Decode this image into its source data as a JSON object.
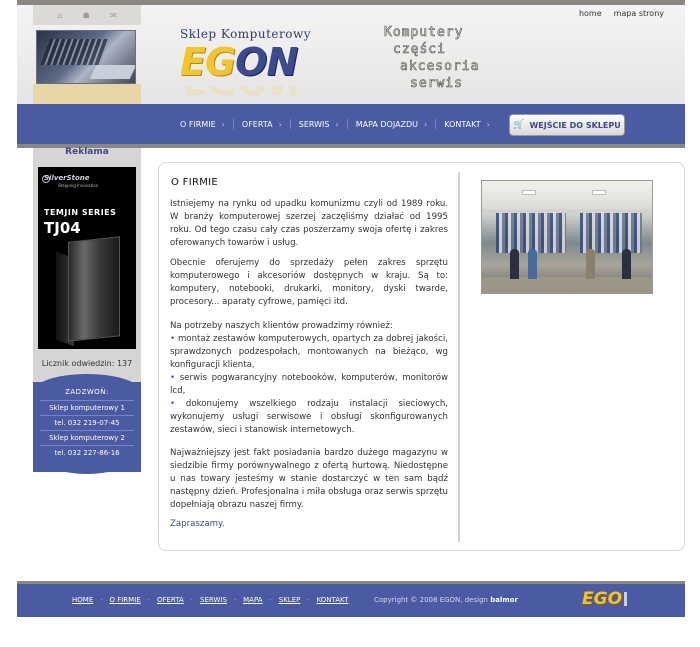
{
  "header": {
    "top_links": [
      "home",
      "mapa strony"
    ],
    "logo_caption": "Sklep Komputerowy",
    "logo_main_yellow": "EG",
    "logo_main_blue": "ON",
    "tagline": [
      "Komputery",
      "części",
      "akcesoria",
      "serwis"
    ]
  },
  "nav": {
    "items": [
      "O FIRMIE",
      "OFERTA",
      "SERWIS",
      "MAPA DOJAZDU",
      "KONTAKT"
    ],
    "shop_button": "WEJŚCIE DO SKLEPU"
  },
  "sidebar": {
    "reklama": "Reklama",
    "ad": {
      "brand": "SilverStone",
      "brand_sub": "Stepping Innovation",
      "series": "TEMJIN SERIES",
      "model": "TJ04"
    },
    "licznik": "Licznik odwiedzin: 137",
    "call": {
      "title": "ZADZWOŃ:",
      "lines": [
        "Sklep komputerowy 1",
        "tel. 032 219-07-45",
        "Sklep komputerowy 2",
        "tel. 032 227-86-16"
      ]
    }
  },
  "main": {
    "title": "O FIRMIE",
    "p1": "Istniejemy na rynku od upadku komunizmu czyli od 1989 roku. W branży komputerowej szerzej zaczęliśmy działać od 1995 roku. Od tego czasu cały czas poszerzamy swoja ofertę i zakres oferowanych towarów i usług.",
    "p2": "Obecnie oferujemy do sprzedaży pełen zakres sprzętu komputerowego i akcesoriów dostępnych w kraju. Są to: komputery, notebooki, drukarki, monitory, dyski twarde, procesory... aparaty cyfrowe, pamięci itd.",
    "p3_intro": "Na potrzeby naszych klientów prowadzimy również:",
    "bullets": [
      "montaż zestawów komputerowych, opartych za dobrej jakości, sprawdzonych podzespołach, montowanych na bieżąco, wg konfiguracji klienta,",
      "serwis pogwarancyjny notebooków, komputerów, monitorów lcd,",
      "dokonujemy wszelkiego rodzaju instalacji sieciowych, wykonujemy usługi serwisowe i obsługi skonfigurowanych zestawów, sieci i stanowisk internetowych."
    ],
    "p4": "Najważniejszy jest fakt posiadania bardzo dużego magazynu w siedzibie firmy porównywalnego z ofertą hurtową. Niedostępne u nas towary jesteśmy w stanie dostarczyć w ten sam bądź następny dzień. Profesjonalna i miła obsługa oraz serwis sprzętu dopełniają obrazu naszej firmy.",
    "closing": "Zapraszamy."
  },
  "footer": {
    "links": [
      "HOME",
      "O FIRMIE",
      "OFERTA",
      "SERWIS",
      "MAPA",
      "SKLEP",
      "KONTAKT"
    ],
    "copyright": "Copyright © 2008 EGON, design",
    "designer": "balmor",
    "logo": "EGO"
  },
  "icons": {
    "left_top": [
      "home-icon",
      "sitemap-icon",
      "mail-icon"
    ],
    "footer_logo": "egon-logo"
  },
  "colors": {
    "accent_blue": "#4a5aa3",
    "gold": "#e8d7a6",
    "logo_yellow": "#f3c52b"
  }
}
